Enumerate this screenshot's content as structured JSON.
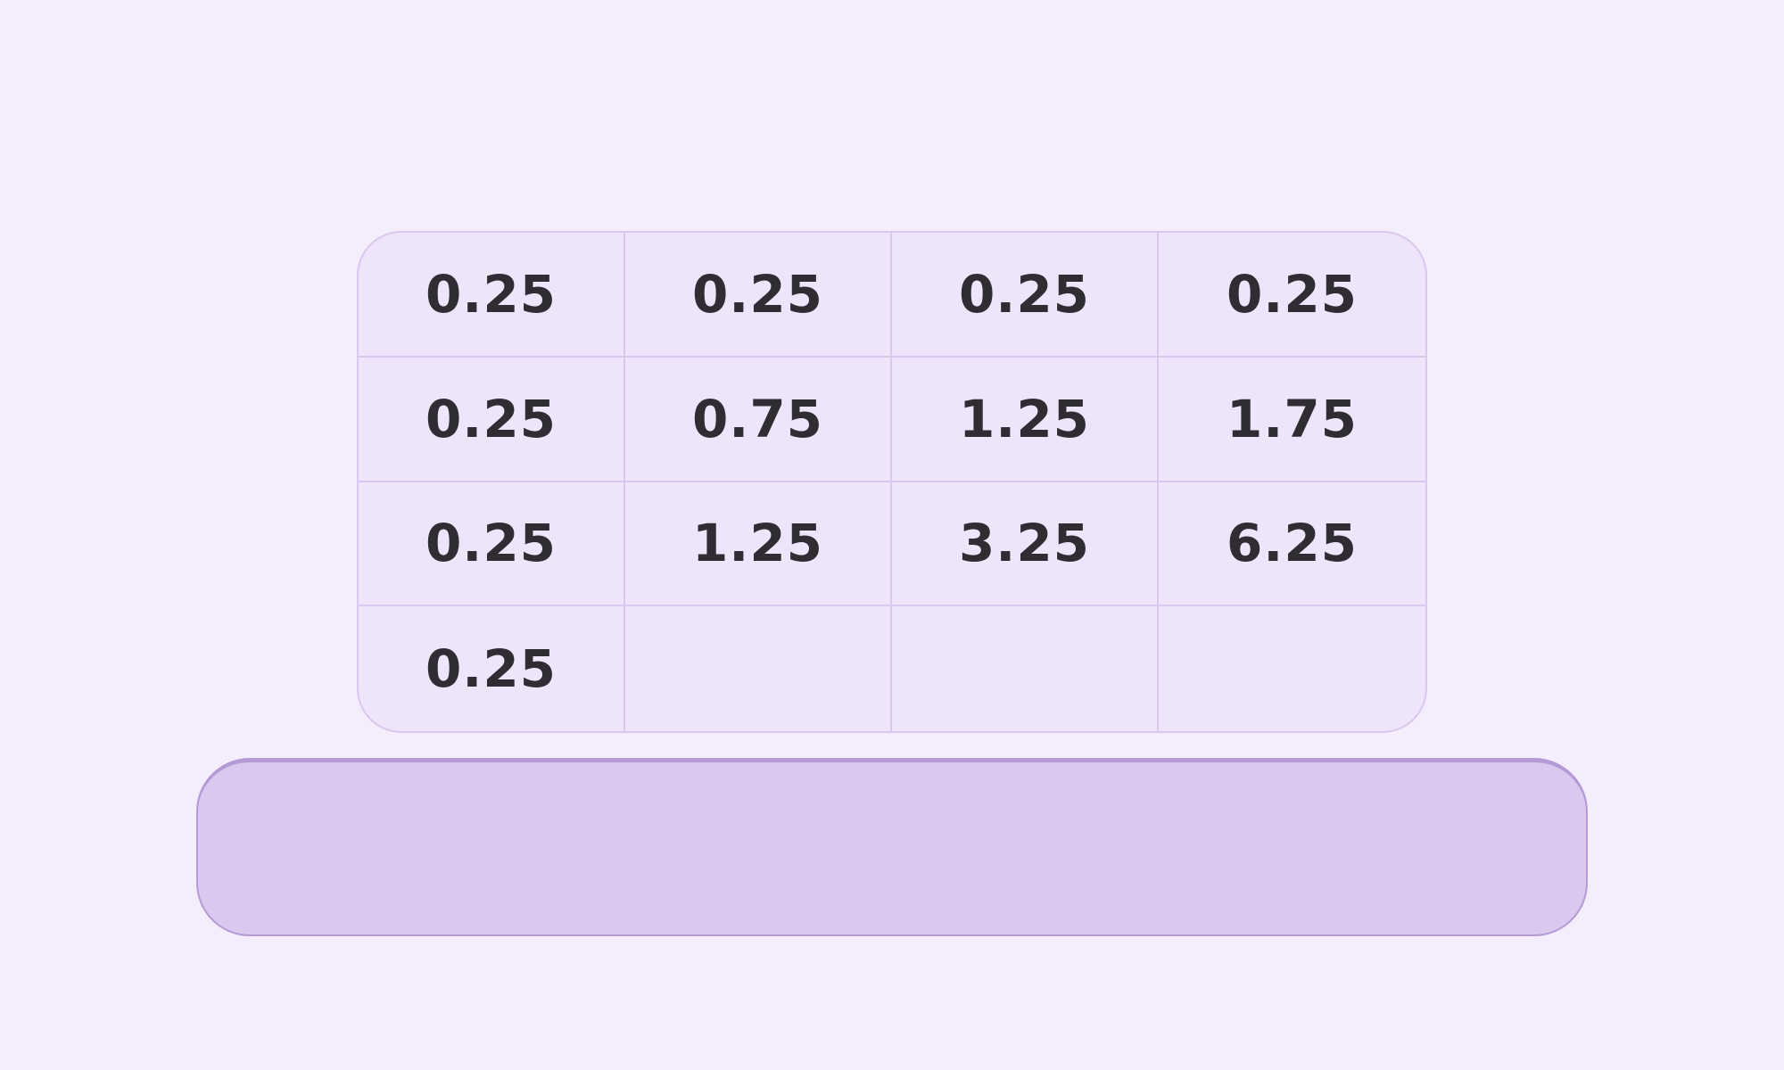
{
  "grid": {
    "rows": [
      [
        "0.25",
        "0.25",
        "0.25",
        "0.25"
      ],
      [
        "0.25",
        "0.75",
        "1.25",
        "1.75"
      ],
      [
        "0.25",
        "1.25",
        "3.25",
        "6.25"
      ],
      [
        "0.25",
        "",
        "",
        ""
      ]
    ]
  },
  "answer": {
    "value": ""
  },
  "colors": {
    "background": "#f4eefc",
    "cell_fill": "#efe5fa",
    "cell_border": "#d9c7ee",
    "answer_fill": "#dac8ee",
    "answer_border": "#b49bd6",
    "text": "#2f2c33"
  }
}
